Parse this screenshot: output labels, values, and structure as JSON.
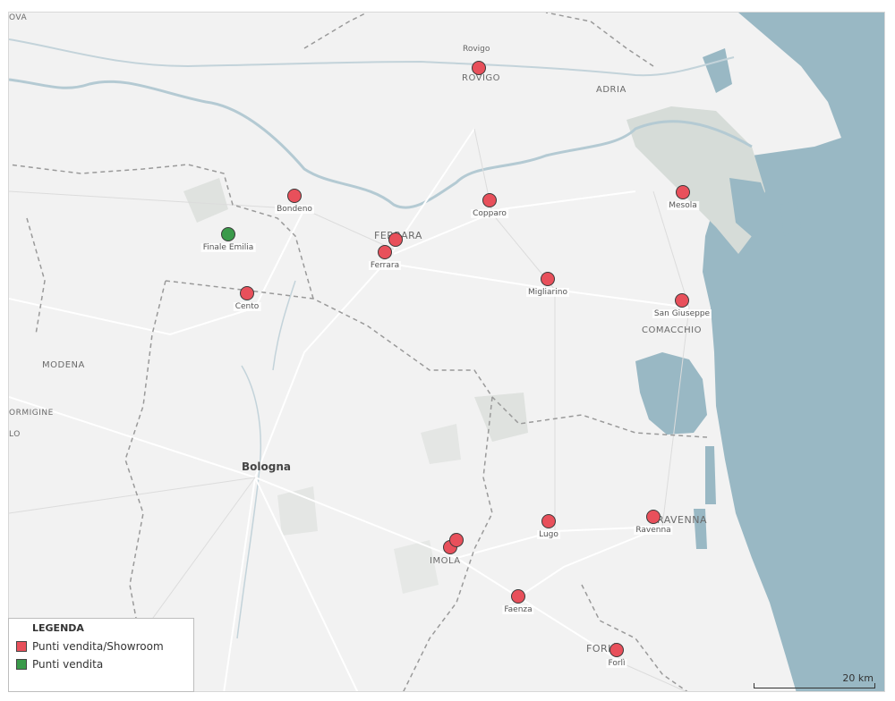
{
  "map": {
    "colors": {
      "sea": "#99b8c4",
      "land": "#f2f2f2",
      "showroom": "#e8505b",
      "store": "#3a9a4a"
    },
    "places": [
      {
        "name": "Rovigo",
        "kind": "label"
      },
      {
        "name": "ROVIGO",
        "kind": "city"
      },
      {
        "name": "ADRIA",
        "kind": "city"
      },
      {
        "name": "FERRARA",
        "kind": "city"
      },
      {
        "name": "COMACCHIO",
        "kind": "city"
      },
      {
        "name": "MODENA",
        "kind": "city"
      },
      {
        "name": "ORMIGINE",
        "kind": "city"
      },
      {
        "name": "LO",
        "kind": "city"
      },
      {
        "name": "OVA",
        "kind": "city"
      },
      {
        "name": "Bologna",
        "kind": "big"
      },
      {
        "name": "IMOLA",
        "kind": "city"
      },
      {
        "name": "RAVENNA",
        "kind": "city"
      },
      {
        "name": "FORLÌ",
        "kind": "city"
      }
    ],
    "points": [
      {
        "label": "ROVIGO",
        "category": "showroom",
        "showLabel": false
      },
      {
        "label": "Bondeno",
        "category": "showroom",
        "showLabel": true
      },
      {
        "label": "Copparo",
        "category": "showroom",
        "showLabel": true
      },
      {
        "label": "Mesola",
        "category": "showroom",
        "showLabel": true
      },
      {
        "label": "Finale Emilia",
        "category": "store",
        "showLabel": true
      },
      {
        "label": "Ferrara A",
        "category": "showroom",
        "showLabel": false
      },
      {
        "label": "Ferrara",
        "category": "showroom",
        "showLabel": true
      },
      {
        "label": "Cento",
        "category": "showroom",
        "showLabel": true
      },
      {
        "label": "Migliarino",
        "category": "showroom",
        "showLabel": true
      },
      {
        "label": "San Giuseppe",
        "category": "showroom",
        "showLabel": true
      },
      {
        "label": "Imola A",
        "category": "showroom",
        "showLabel": false
      },
      {
        "label": "Imola B",
        "category": "showroom",
        "showLabel": false
      },
      {
        "label": "Lugo",
        "category": "showroom",
        "showLabel": true
      },
      {
        "label": "Ravenna",
        "category": "showroom",
        "showLabel": true
      },
      {
        "label": "Faenza",
        "category": "showroom",
        "showLabel": true
      },
      {
        "label": "Forlì",
        "category": "showroom",
        "showLabel": true
      }
    ]
  },
  "legend": {
    "title": "LEGENDA",
    "items": [
      {
        "label": "Punti vendita/Showroom",
        "category": "showroom"
      },
      {
        "label": "Punti vendita",
        "category": "store"
      }
    ]
  },
  "scale": {
    "label": "20 km"
  }
}
